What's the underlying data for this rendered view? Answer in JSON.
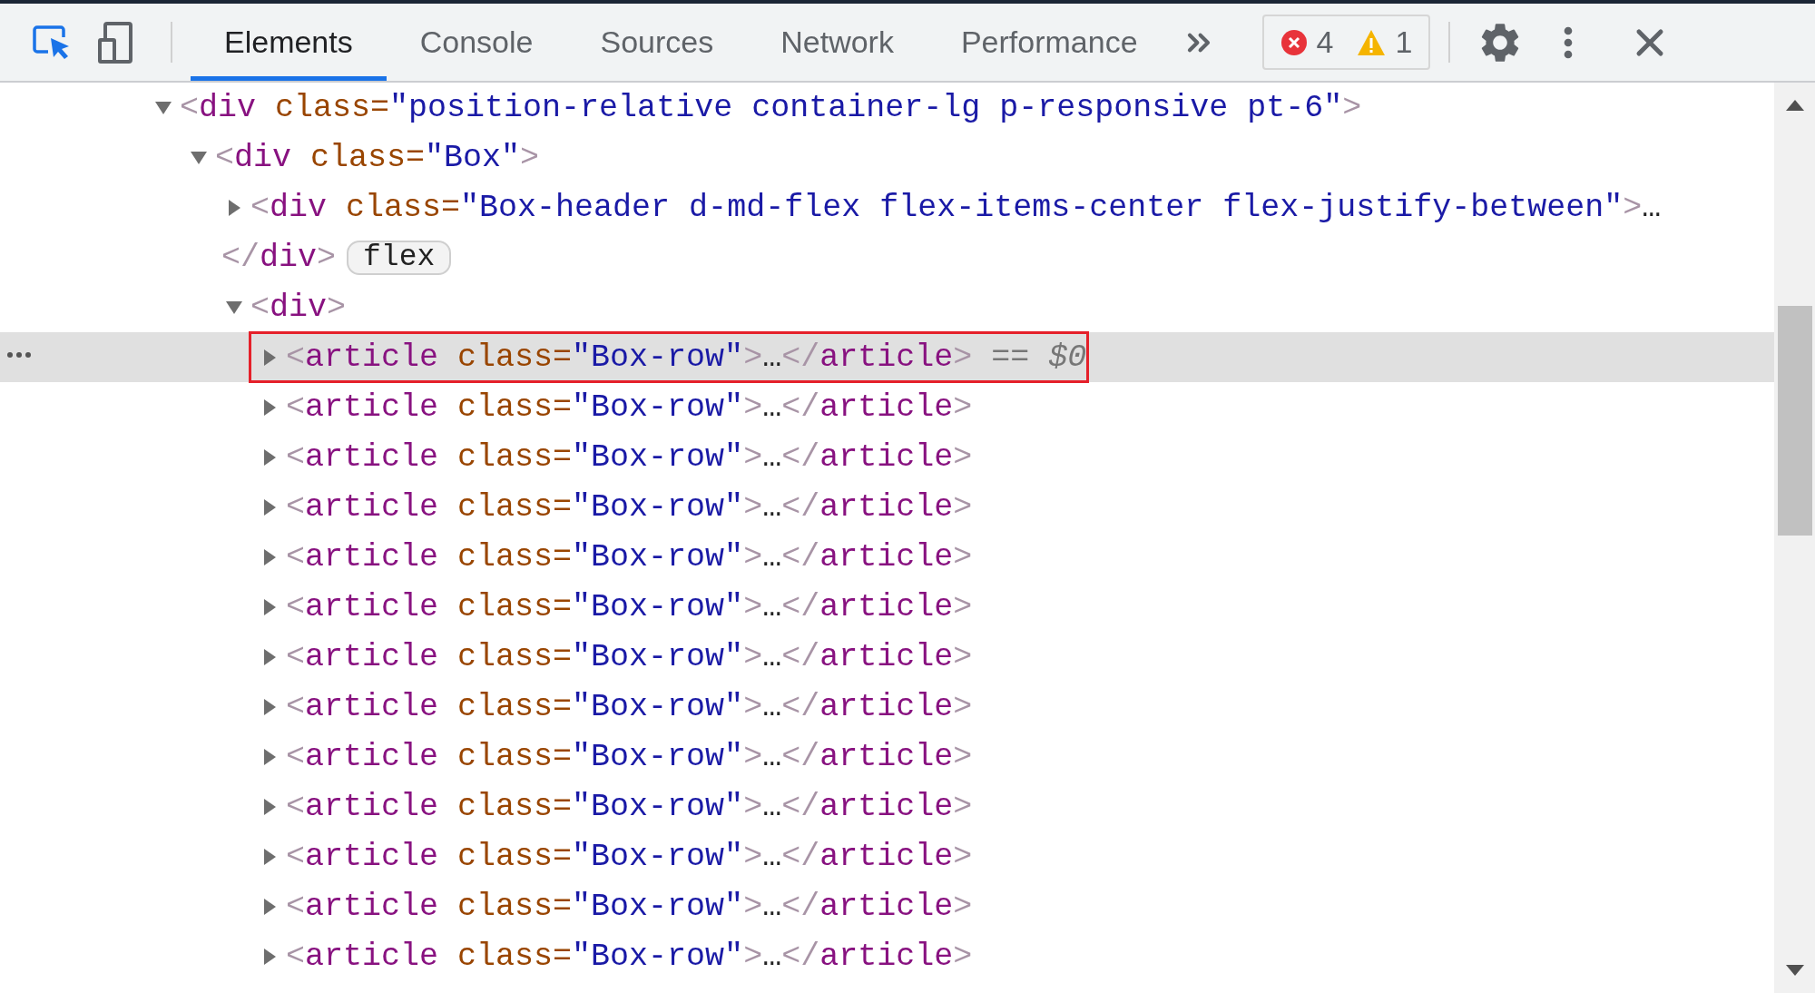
{
  "toolbar": {
    "tabs": [
      {
        "label": "Elements",
        "selected": true
      },
      {
        "label": "Console",
        "selected": false
      },
      {
        "label": "Sources",
        "selected": false
      },
      {
        "label": "Network",
        "selected": false
      },
      {
        "label": "Performance",
        "selected": false
      }
    ],
    "errors": "4",
    "warnings": "1"
  },
  "tree": {
    "nodes": [
      {
        "expanded": true,
        "selected": false,
        "lines": [
          [
            {
              "kind": "bracket",
              "text": "<"
            },
            {
              "kind": "tag",
              "text": "div"
            },
            {
              "kind": "attr",
              "text": " class"
            },
            {
              "kind": "eq",
              "text": "="
            },
            {
              "kind": "value",
              "text": "\"position-relative container-lg p-responsive pt-6\""
            },
            {
              "kind": "bracket",
              "text": ">"
            }
          ]
        ],
        "children": [
          {
            "expanded": true,
            "selected": false,
            "lines": [
              [
                {
                  "kind": "bracket",
                  "text": "<"
                },
                {
                  "kind": "tag",
                  "text": "div"
                },
                {
                  "kind": "attr",
                  "text": " class"
                },
                {
                  "kind": "eq",
                  "text": "="
                },
                {
                  "kind": "value",
                  "text": "\"Box\""
                },
                {
                  "kind": "bracket",
                  "text": ">"
                }
              ]
            ],
            "children": [
              {
                "expanded": false,
                "selected": false,
                "lines": [
                  [
                    {
                      "kind": "bracket",
                      "text": "<"
                    },
                    {
                      "kind": "tag",
                      "text": "div"
                    },
                    {
                      "kind": "attr",
                      "text": " class"
                    },
                    {
                      "kind": "eq",
                      "text": "="
                    },
                    {
                      "kind": "value",
                      "text": "\"Box-header d-md-flex flex-items-center flex-justify-between\""
                    },
                    {
                      "kind": "bracket",
                      "text": ">"
                    },
                    {
                      "kind": "ellipsis",
                      "text": "…"
                    }
                  ],
                  [
                    {
                      "kind": "bracket",
                      "text": "</"
                    },
                    {
                      "kind": "tag",
                      "text": "div"
                    },
                    {
                      "kind": "bracket",
                      "text": ">"
                    }
                  ]
                ],
                "badge": "flex"
              },
              {
                "expanded": true,
                "selected": false,
                "lines": [
                  [
                    {
                      "kind": "bracket",
                      "text": "<"
                    },
                    {
                      "kind": "tag",
                      "text": "div"
                    },
                    {
                      "kind": "bracket",
                      "text": ">"
                    }
                  ]
                ],
                "children": [
                  {
                    "expanded": false,
                    "selected": true,
                    "lines": [
                      [
                        {
                          "kind": "bracket",
                          "text": "<"
                        },
                        {
                          "kind": "tag",
                          "text": "article"
                        },
                        {
                          "kind": "attr",
                          "text": " class"
                        },
                        {
                          "kind": "eq",
                          "text": "="
                        },
                        {
                          "kind": "value",
                          "text": "\"Box-row\""
                        },
                        {
                          "kind": "bracket",
                          "text": ">"
                        },
                        {
                          "kind": "ellipsis",
                          "text": "…"
                        },
                        {
                          "kind": "bracket",
                          "text": "</"
                        },
                        {
                          "kind": "tag",
                          "text": "article"
                        },
                        {
                          "kind": "bracket",
                          "text": ">"
                        },
                        {
                          "kind": "ref",
                          "text": " == $0"
                        }
                      ]
                    ]
                  },
                  {
                    "expanded": false,
                    "selected": false,
                    "lines": [
                      [
                        {
                          "kind": "bracket",
                          "text": "<"
                        },
                        {
                          "kind": "tag",
                          "text": "article"
                        },
                        {
                          "kind": "attr",
                          "text": " class"
                        },
                        {
                          "kind": "eq",
                          "text": "="
                        },
                        {
                          "kind": "value",
                          "text": "\"Box-row\""
                        },
                        {
                          "kind": "bracket",
                          "text": ">"
                        },
                        {
                          "kind": "ellipsis",
                          "text": "…"
                        },
                        {
                          "kind": "bracket",
                          "text": "</"
                        },
                        {
                          "kind": "tag",
                          "text": "article"
                        },
                        {
                          "kind": "bracket",
                          "text": ">"
                        }
                      ]
                    ]
                  },
                  {
                    "expanded": false,
                    "selected": false,
                    "lines": [
                      [
                        {
                          "kind": "bracket",
                          "text": "<"
                        },
                        {
                          "kind": "tag",
                          "text": "article"
                        },
                        {
                          "kind": "attr",
                          "text": " class"
                        },
                        {
                          "kind": "eq",
                          "text": "="
                        },
                        {
                          "kind": "value",
                          "text": "\"Box-row\""
                        },
                        {
                          "kind": "bracket",
                          "text": ">"
                        },
                        {
                          "kind": "ellipsis",
                          "text": "…"
                        },
                        {
                          "kind": "bracket",
                          "text": "</"
                        },
                        {
                          "kind": "tag",
                          "text": "article"
                        },
                        {
                          "kind": "bracket",
                          "text": ">"
                        }
                      ]
                    ]
                  },
                  {
                    "expanded": false,
                    "selected": false,
                    "lines": [
                      [
                        {
                          "kind": "bracket",
                          "text": "<"
                        },
                        {
                          "kind": "tag",
                          "text": "article"
                        },
                        {
                          "kind": "attr",
                          "text": " class"
                        },
                        {
                          "kind": "eq",
                          "text": "="
                        },
                        {
                          "kind": "value",
                          "text": "\"Box-row\""
                        },
                        {
                          "kind": "bracket",
                          "text": ">"
                        },
                        {
                          "kind": "ellipsis",
                          "text": "…"
                        },
                        {
                          "kind": "bracket",
                          "text": "</"
                        },
                        {
                          "kind": "tag",
                          "text": "article"
                        },
                        {
                          "kind": "bracket",
                          "text": ">"
                        }
                      ]
                    ]
                  },
                  {
                    "expanded": false,
                    "selected": false,
                    "lines": [
                      [
                        {
                          "kind": "bracket",
                          "text": "<"
                        },
                        {
                          "kind": "tag",
                          "text": "article"
                        },
                        {
                          "kind": "attr",
                          "text": " class"
                        },
                        {
                          "kind": "eq",
                          "text": "="
                        },
                        {
                          "kind": "value",
                          "text": "\"Box-row\""
                        },
                        {
                          "kind": "bracket",
                          "text": ">"
                        },
                        {
                          "kind": "ellipsis",
                          "text": "…"
                        },
                        {
                          "kind": "bracket",
                          "text": "</"
                        },
                        {
                          "kind": "tag",
                          "text": "article"
                        },
                        {
                          "kind": "bracket",
                          "text": ">"
                        }
                      ]
                    ]
                  },
                  {
                    "expanded": false,
                    "selected": false,
                    "lines": [
                      [
                        {
                          "kind": "bracket",
                          "text": "<"
                        },
                        {
                          "kind": "tag",
                          "text": "article"
                        },
                        {
                          "kind": "attr",
                          "text": " class"
                        },
                        {
                          "kind": "eq",
                          "text": "="
                        },
                        {
                          "kind": "value",
                          "text": "\"Box-row\""
                        },
                        {
                          "kind": "bracket",
                          "text": ">"
                        },
                        {
                          "kind": "ellipsis",
                          "text": "…"
                        },
                        {
                          "kind": "bracket",
                          "text": "</"
                        },
                        {
                          "kind": "tag",
                          "text": "article"
                        },
                        {
                          "kind": "bracket",
                          "text": ">"
                        }
                      ]
                    ]
                  },
                  {
                    "expanded": false,
                    "selected": false,
                    "lines": [
                      [
                        {
                          "kind": "bracket",
                          "text": "<"
                        },
                        {
                          "kind": "tag",
                          "text": "article"
                        },
                        {
                          "kind": "attr",
                          "text": " class"
                        },
                        {
                          "kind": "eq",
                          "text": "="
                        },
                        {
                          "kind": "value",
                          "text": "\"Box-row\""
                        },
                        {
                          "kind": "bracket",
                          "text": ">"
                        },
                        {
                          "kind": "ellipsis",
                          "text": "…"
                        },
                        {
                          "kind": "bracket",
                          "text": "</"
                        },
                        {
                          "kind": "tag",
                          "text": "article"
                        },
                        {
                          "kind": "bracket",
                          "text": ">"
                        }
                      ]
                    ]
                  },
                  {
                    "expanded": false,
                    "selected": false,
                    "lines": [
                      [
                        {
                          "kind": "bracket",
                          "text": "<"
                        },
                        {
                          "kind": "tag",
                          "text": "article"
                        },
                        {
                          "kind": "attr",
                          "text": " class"
                        },
                        {
                          "kind": "eq",
                          "text": "="
                        },
                        {
                          "kind": "value",
                          "text": "\"Box-row\""
                        },
                        {
                          "kind": "bracket",
                          "text": ">"
                        },
                        {
                          "kind": "ellipsis",
                          "text": "…"
                        },
                        {
                          "kind": "bracket",
                          "text": "</"
                        },
                        {
                          "kind": "tag",
                          "text": "article"
                        },
                        {
                          "kind": "bracket",
                          "text": ">"
                        }
                      ]
                    ]
                  },
                  {
                    "expanded": false,
                    "selected": false,
                    "lines": [
                      [
                        {
                          "kind": "bracket",
                          "text": "<"
                        },
                        {
                          "kind": "tag",
                          "text": "article"
                        },
                        {
                          "kind": "attr",
                          "text": " class"
                        },
                        {
                          "kind": "eq",
                          "text": "="
                        },
                        {
                          "kind": "value",
                          "text": "\"Box-row\""
                        },
                        {
                          "kind": "bracket",
                          "text": ">"
                        },
                        {
                          "kind": "ellipsis",
                          "text": "…"
                        },
                        {
                          "kind": "bracket",
                          "text": "</"
                        },
                        {
                          "kind": "tag",
                          "text": "article"
                        },
                        {
                          "kind": "bracket",
                          "text": ">"
                        }
                      ]
                    ]
                  },
                  {
                    "expanded": false,
                    "selected": false,
                    "lines": [
                      [
                        {
                          "kind": "bracket",
                          "text": "<"
                        },
                        {
                          "kind": "tag",
                          "text": "article"
                        },
                        {
                          "kind": "attr",
                          "text": " class"
                        },
                        {
                          "kind": "eq",
                          "text": "="
                        },
                        {
                          "kind": "value",
                          "text": "\"Box-row\""
                        },
                        {
                          "kind": "bracket",
                          "text": ">"
                        },
                        {
                          "kind": "ellipsis",
                          "text": "…"
                        },
                        {
                          "kind": "bracket",
                          "text": "</"
                        },
                        {
                          "kind": "tag",
                          "text": "article"
                        },
                        {
                          "kind": "bracket",
                          "text": ">"
                        }
                      ]
                    ]
                  },
                  {
                    "expanded": false,
                    "selected": false,
                    "lines": [
                      [
                        {
                          "kind": "bracket",
                          "text": "<"
                        },
                        {
                          "kind": "tag",
                          "text": "article"
                        },
                        {
                          "kind": "attr",
                          "text": " class"
                        },
                        {
                          "kind": "eq",
                          "text": "="
                        },
                        {
                          "kind": "value",
                          "text": "\"Box-row\""
                        },
                        {
                          "kind": "bracket",
                          "text": ">"
                        },
                        {
                          "kind": "ellipsis",
                          "text": "…"
                        },
                        {
                          "kind": "bracket",
                          "text": "</"
                        },
                        {
                          "kind": "tag",
                          "text": "article"
                        },
                        {
                          "kind": "bracket",
                          "text": ">"
                        }
                      ]
                    ]
                  },
                  {
                    "expanded": false,
                    "selected": false,
                    "lines": [
                      [
                        {
                          "kind": "bracket",
                          "text": "<"
                        },
                        {
                          "kind": "tag",
                          "text": "article"
                        },
                        {
                          "kind": "attr",
                          "text": " class"
                        },
                        {
                          "kind": "eq",
                          "text": "="
                        },
                        {
                          "kind": "value",
                          "text": "\"Box-row\""
                        },
                        {
                          "kind": "bracket",
                          "text": ">"
                        },
                        {
                          "kind": "ellipsis",
                          "text": "…"
                        },
                        {
                          "kind": "bracket",
                          "text": "</"
                        },
                        {
                          "kind": "tag",
                          "text": "article"
                        },
                        {
                          "kind": "bracket",
                          "text": ">"
                        }
                      ]
                    ]
                  },
                  {
                    "expanded": false,
                    "selected": false,
                    "lines": [
                      [
                        {
                          "kind": "bracket",
                          "text": "<"
                        },
                        {
                          "kind": "tag",
                          "text": "article"
                        },
                        {
                          "kind": "attr",
                          "text": " class"
                        },
                        {
                          "kind": "eq",
                          "text": "="
                        },
                        {
                          "kind": "value",
                          "text": "\"Box-row\""
                        },
                        {
                          "kind": "bracket",
                          "text": ">"
                        },
                        {
                          "kind": "ellipsis",
                          "text": "…"
                        },
                        {
                          "kind": "bracket",
                          "text": "</"
                        },
                        {
                          "kind": "tag",
                          "text": "article"
                        },
                        {
                          "kind": "bracket",
                          "text": ">"
                        }
                      ]
                    ]
                  }
                ]
              }
            ]
          }
        ]
      }
    ]
  }
}
